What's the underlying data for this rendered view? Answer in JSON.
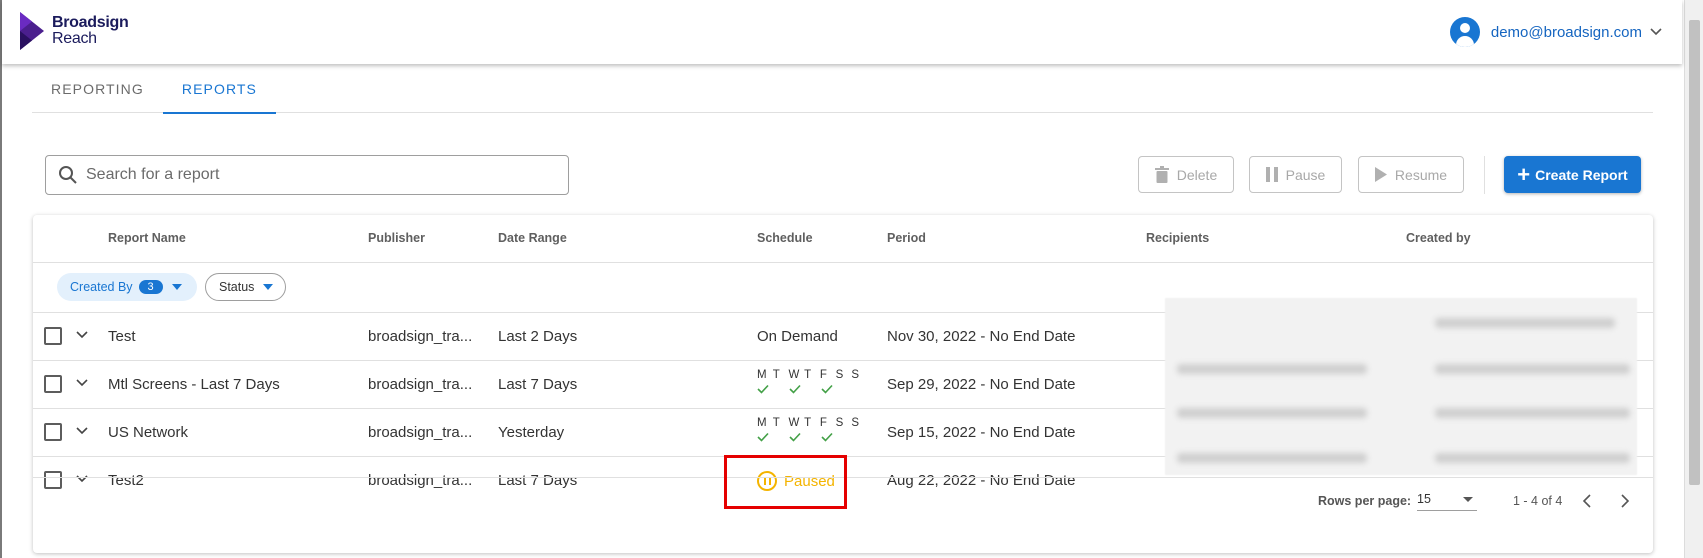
{
  "header": {
    "brand_line1": "Broadsign",
    "brand_line2": "Reach",
    "user_email": "demo@broadsign.com"
  },
  "tabs": [
    {
      "label": "REPORTING",
      "active": false
    },
    {
      "label": "REPORTS",
      "active": true
    }
  ],
  "toolbar": {
    "search_placeholder": "Search for a report",
    "delete_label": "Delete",
    "pause_label": "Pause",
    "resume_label": "Resume",
    "create_label": "Create Report"
  },
  "table": {
    "columns": [
      "Report Name",
      "Publisher",
      "Date Range",
      "Schedule",
      "Period",
      "Recipients",
      "Created by"
    ],
    "filters": {
      "created_by_label": "Created By",
      "created_by_count": "3",
      "status_label": "Status"
    },
    "weekday_letters": [
      "M",
      "T",
      "W",
      "T",
      "F",
      "S",
      "S"
    ],
    "rows": [
      {
        "name": "Test",
        "publisher": "broadsign_tra...",
        "date_range": "Last 2 Days",
        "schedule": "On Demand",
        "period": "Nov 30, 2022 - No End Date"
      },
      {
        "name": "Mtl Screens - Last 7 Days",
        "publisher": "broadsign_tra...",
        "date_range": "Last 7 Days",
        "schedule": "weekly",
        "period": "Sep 29, 2022 - No End Date"
      },
      {
        "name": "US Network",
        "publisher": "broadsign_tra...",
        "date_range": "Yesterday",
        "schedule": "weekly",
        "period": "Sep 15, 2022 - No End Date"
      },
      {
        "name": "Test2",
        "publisher": "broadsign_tra...",
        "date_range": "Last 7 Days",
        "schedule": "Paused",
        "period": "Aug 22, 2022 - No End Date"
      }
    ]
  },
  "pagination": {
    "rows_per_page_label": "Rows per page:",
    "rows_per_page_value": "15",
    "range_text": "1 - 4 of 4"
  },
  "colors": {
    "primary": "#1976d2",
    "paused": "#f4b400",
    "highlight": "#e50000",
    "check": "#43a047"
  }
}
